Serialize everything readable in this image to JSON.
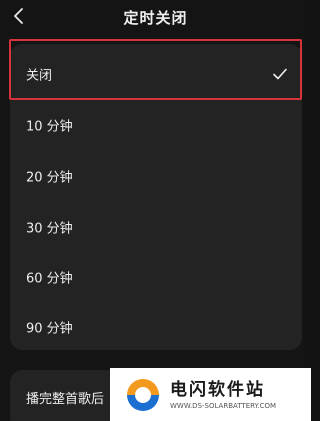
{
  "header": {
    "title": "定时关闭"
  },
  "options": [
    {
      "label": "关闭",
      "selected": true
    },
    {
      "label": "10 分钟",
      "selected": false
    },
    {
      "label": "20 分钟",
      "selected": false
    },
    {
      "label": "30 分钟",
      "selected": false
    },
    {
      "label": "60 分钟",
      "selected": false
    },
    {
      "label": "90 分钟",
      "selected": false
    }
  ],
  "extra_option": {
    "label": "播完整首歌后"
  },
  "watermark": {
    "title": "电闪软件站",
    "url": "WWW.DS-SOLARBATTERY.COM"
  },
  "colors": {
    "highlight": "#d6333b",
    "background": "#141414",
    "card": "#232323"
  }
}
